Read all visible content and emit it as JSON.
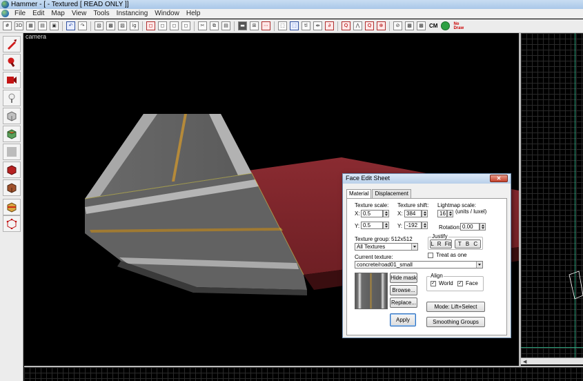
{
  "window": {
    "title": "Hammer - [ - Textured [ READ ONLY ]]"
  },
  "menu": [
    "File",
    "Edit",
    "Map",
    "View",
    "Tools",
    "Instancing",
    "Window",
    "Help"
  ],
  "toolbar": {
    "buttons": [
      "grid-icon",
      "3d-icon",
      "grid-small-icon",
      "grid-large-icon",
      "snap-icon",
      "undo-icon",
      "redo-icon",
      "carve-icon",
      "group-icon",
      "ungroup-icon",
      "ignore-group-icon",
      "hide-icon",
      "unhide-icon",
      "cordon-icon",
      "cut-icon",
      "copy-icon",
      "paste-icon",
      "texture-lock-icon",
      "texture-scale-icon",
      "dotted-icon",
      "select-icon",
      "zoom-icon",
      "vertex-icon",
      "entity-icon",
      "move-icon",
      "compile-icon",
      "clip-icon",
      "decal-icon",
      "overlay-icon",
      "wireframe-icon",
      "flat-icon"
    ],
    "text_items": {
      "cm": "CM",
      "no_draw": "No\nDraw"
    }
  },
  "palette": {
    "tools": [
      "selection-tool-icon",
      "magnify-tool-icon",
      "camera-tool-icon",
      "entity-tool-icon",
      "block-tool-icon",
      "texture-application-icon",
      "apply-texture-icon",
      "decal-tool-icon",
      "overlay-tool-icon",
      "clipping-tool-icon",
      "vertex-tool-icon",
      "path-tool-icon"
    ]
  },
  "viewport": {
    "label": "camera"
  },
  "face_edit": {
    "title": "Face Edit Sheet",
    "close_label": "✕",
    "tabs": [
      "Material",
      "Displacement"
    ],
    "texture_scale_label": "Texture scale:",
    "texture_shift_label": "Texture shift:",
    "lightmap_scale_label": "Lightmap scale:",
    "units_label": "(units / luxel)",
    "x_label": "X:",
    "y_label": "Y:",
    "scale_x": "0.5",
    "scale_y": "0.5",
    "shift_x": "384",
    "shift_y": "-192",
    "lightmap_value": "16",
    "rotation_label": "Rotation:",
    "rotation_value": "0.00",
    "texture_group_label": "Texture group:",
    "texture_size": "512x512",
    "texture_group_value": "All Textures",
    "justify_label": "Justify",
    "justify_buttons": [
      "L",
      "R",
      "Fit",
      "T",
      "B",
      "C"
    ],
    "treat_as_one_label": "Treat as one",
    "current_texture_label": "Current texture:",
    "current_texture_value": "concrete/road01_small",
    "hide_mask_label": "Hide mask",
    "browse_label": "Browse...",
    "replace_label": "Replace...",
    "apply_label": "Apply",
    "align_label": "Align",
    "align_world_label": "World",
    "align_face_label": "Face",
    "mode_label": "Mode: Lift+Select",
    "smoothing_label": "Smoothing Groups"
  }
}
